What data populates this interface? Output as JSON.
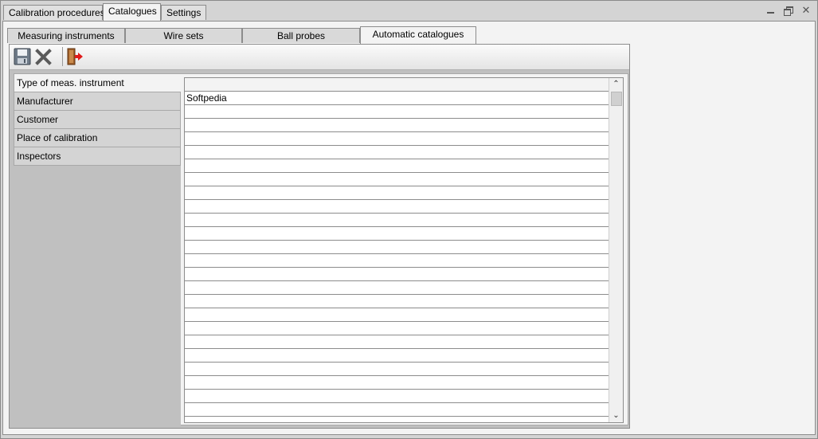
{
  "top_tabs": [
    {
      "label": "Calibration procedures"
    },
    {
      "label": "Catalogues"
    },
    {
      "label": "Settings"
    }
  ],
  "sub_tabs": [
    {
      "label": "Measuring instruments"
    },
    {
      "label": "Wire sets"
    },
    {
      "label": "Ball probes"
    },
    {
      "label": "Automatic catalogues"
    }
  ],
  "window_controls": {
    "minimize_icon": "minimize-icon",
    "restore_icon": "restore-icon",
    "close_icon": "close-icon"
  },
  "toolbar": {
    "icons": [
      "save-icon",
      "delete-icon",
      "exit-icon"
    ]
  },
  "catalogue_list": [
    {
      "label": "Type of meas. instrument"
    },
    {
      "label": "Manufacturer"
    },
    {
      "label": "Customer"
    },
    {
      "label": "Place of calibration"
    },
    {
      "label": "Inspectors"
    }
  ],
  "grid": {
    "header": "",
    "rows": [
      "Softpedia",
      "",
      "",
      "",
      "",
      "",
      "",
      "",
      "",
      "",
      "",
      "",
      "",
      "",
      "",
      "",
      "",
      "",
      "",
      "",
      "",
      "",
      "",
      "",
      ""
    ]
  },
  "colors": {
    "panel": "#f3f3f3",
    "background": "#d4d4d4",
    "border": "#8c8c8c"
  }
}
